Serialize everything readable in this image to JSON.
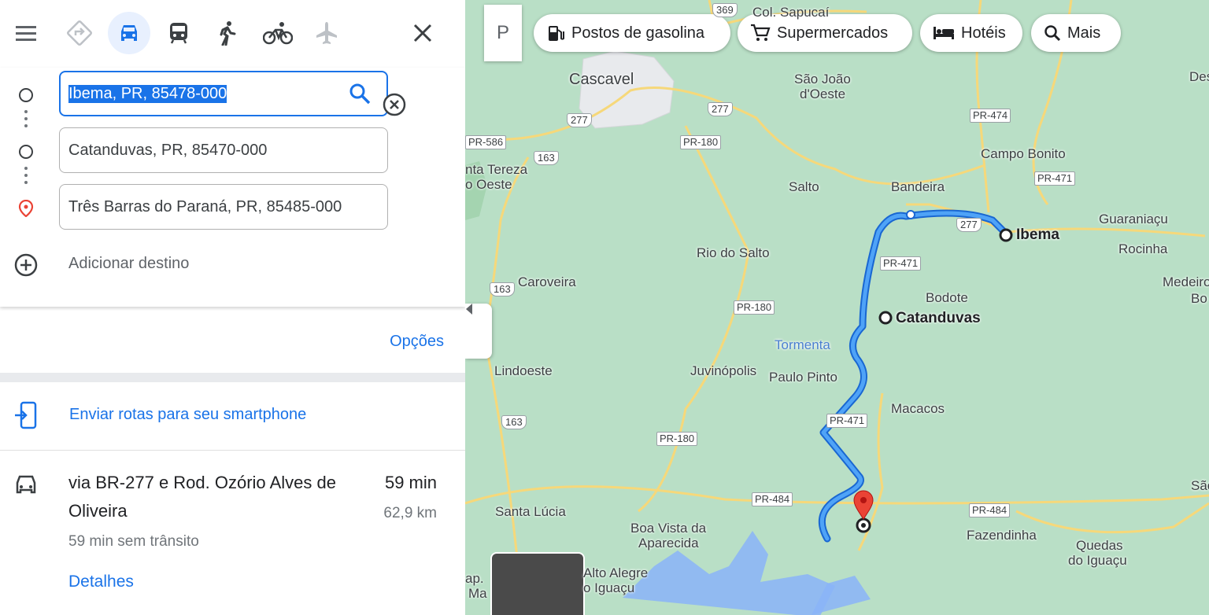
{
  "modes": [
    "best-route-icon",
    "car-icon",
    "transit-icon",
    "walking-icon",
    "bicycle-icon",
    "flight-icon"
  ],
  "inputs": {
    "origin": "Ibema, PR, 85478-000",
    "stop": "Catanduvas, PR, 85470-000",
    "destination": "Três Barras do Paraná, PR, 85485-000"
  },
  "add_destination": "Adicionar destino",
  "options_label": "Opções",
  "send_to_phone": "Enviar rotas para seu smartphone",
  "route": {
    "title": "via BR-277 e Rod. Ozório Alves de Oliveira",
    "duration": "59 min",
    "distance": "62,9 km",
    "traffic": "59 min sem trânsito",
    "details": "Detalhes"
  },
  "map": {
    "layers_label": "P",
    "chips": [
      "Postos de gasolina",
      "Supermercados",
      "Hotéis",
      "Mais"
    ],
    "places": {
      "cascavel": "Cascavel",
      "sao_joao": "São João",
      "doeste": "d'Oeste",
      "campo_bonito": "Campo Bonito",
      "salto": "Salto",
      "bandeira": "Bandeira",
      "guaraniacu": "Guaraniaçu",
      "ibema": "Ibema",
      "rocinha": "Rocinha",
      "rio_do_salto": "Rio do Salto",
      "caroveira": "Caroveira",
      "bodote": "Bodote",
      "catanduvas": "Catanduvas",
      "tormenta": "Tormenta",
      "lindoeste": "Lindoeste",
      "juvinopolis": "Juvinópolis",
      "paulo_pinto": "Paulo Pinto",
      "macacos": "Macacos",
      "santa_lucia": "Santa Lúcia",
      "boa_vista": "Boa Vista da",
      "aparecida": "Aparecida",
      "fazendinha": "Fazendinha",
      "quedas": "Quedas",
      "do_iguacu": "do Iguaçu",
      "alto_alegre": "Alto Alegre",
      "alto_iguacu": "o Iguaçu",
      "santa_tereza": "nta Tereza",
      "santa_tereza2": "o Oeste",
      "medeiro": "Medeiro",
      "bo": "Bo",
      "des": "Des",
      "sao": "São",
      "col_sapucai": "Col. Sapucaí",
      "lap": "ap.",
      "ma": "Ma"
    },
    "shields": {
      "s369": "369",
      "s277a": "277",
      "s277b": "277",
      "s277c": "277",
      "s163a": "163",
      "s163b": "163",
      "s163c": "163",
      "pr586": "PR-586",
      "pr180a": "PR-180",
      "pr180b": "PR-180",
      "pr180c": "PR-180",
      "pr474": "PR-474",
      "pr471a": "PR-471",
      "pr471b": "PR-471",
      "pr471c": "PR-471",
      "pr484a": "PR-484",
      "pr484b": "PR-484"
    }
  }
}
